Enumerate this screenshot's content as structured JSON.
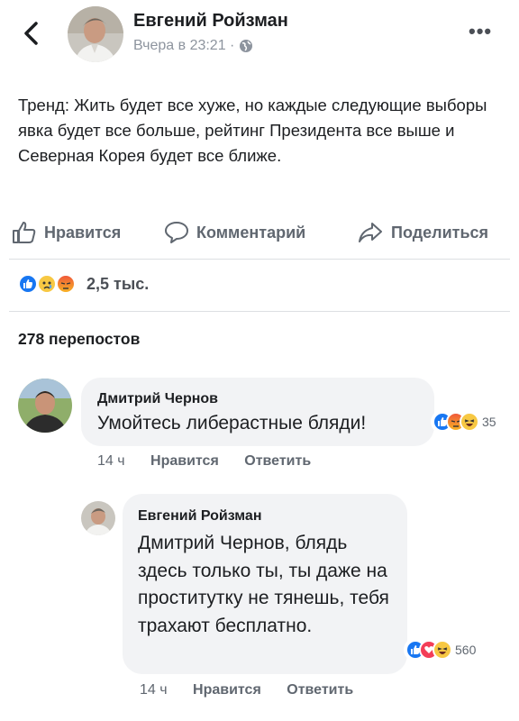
{
  "post": {
    "author": "Евгений Ройзман",
    "time": "Вчера в 23:21 ·",
    "text": "Тренд: Жить будет все  хуже, но каждые следующие выборы явка будет все больше, рейтинг  Президента все выше и Северная Корея будет все ближе.",
    "more_label": "•••"
  },
  "actions": {
    "like": "Нравится",
    "comment": "Комментарий",
    "share": "Поделиться"
  },
  "summary": {
    "reactions": [
      "like-icon",
      "sad-icon",
      "angry-icon"
    ],
    "count": "2,5 тыс.",
    "shares": "278 перепостов"
  },
  "comments": [
    {
      "author": "Дмитрий Чернов",
      "text": "Умойтесь либерастные бляди!",
      "time": "14 ч",
      "like": "Нравится",
      "reply": "Ответить",
      "reactions": [
        "like-icon",
        "angry-icon",
        "haha-icon"
      ],
      "count": "35"
    },
    {
      "author": "Евгений Ройзман",
      "text": "Дмитрий Чернов, блядь здесь только ты, ты даже на проститутку не тянешь, тебя трахают бесплатно.",
      "time": "14 ч",
      "like": "Нравится",
      "reply": "Ответить",
      "reactions": [
        "like-icon",
        "love-icon",
        "haha-icon"
      ],
      "count": "560"
    }
  ],
  "colors": {
    "like": "#1877f2",
    "love": "#f33e58",
    "yellow": "#f7c843",
    "gray_text": "#606770"
  }
}
